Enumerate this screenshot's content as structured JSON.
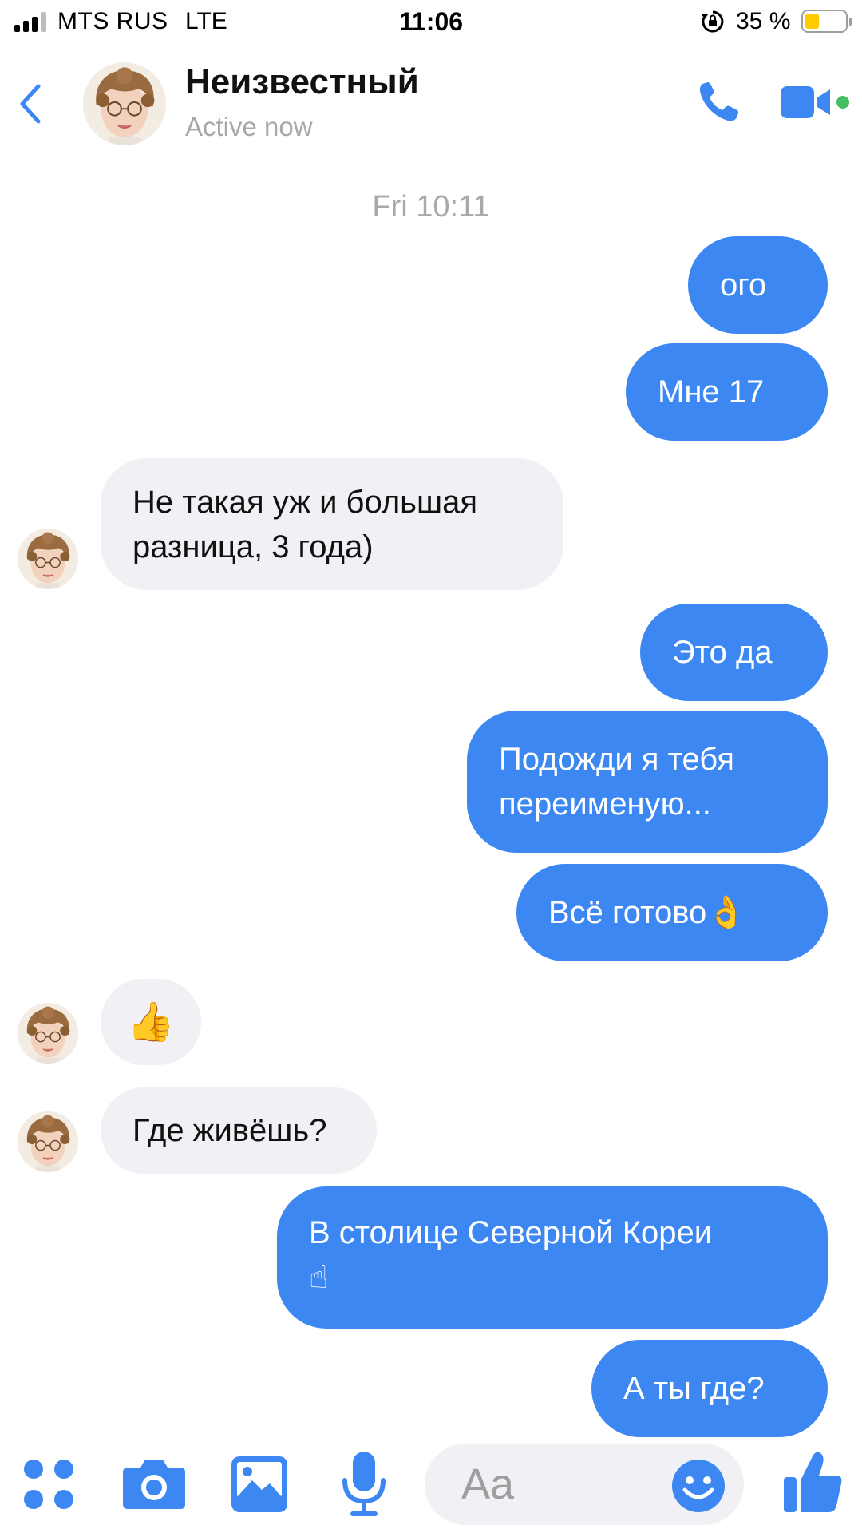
{
  "status_bar": {
    "carrier": "MTS RUS",
    "network": "LTE",
    "time": "11:06",
    "battery_percent": "35 %",
    "battery_level": 0.35,
    "signal_bars": 3,
    "signal_total": 4
  },
  "header": {
    "contact_name": "Неизвестный",
    "contact_status": "Active now",
    "back_icon": "chevron-left-icon",
    "call_icon": "phone-icon",
    "video_icon": "video-camera-icon"
  },
  "conversation": {
    "timestamp": "Fri 10:11",
    "messages": [
      {
        "from": "me",
        "text": "ого"
      },
      {
        "from": "me",
        "text": "Мне 17"
      },
      {
        "from": "them",
        "text": "Не такая уж и большая разница, 3 года)"
      },
      {
        "from": "me",
        "text": "Это да"
      },
      {
        "from": "me",
        "text": "Подожди я тебя переименую..."
      },
      {
        "from": "me",
        "text": "Всё готово",
        "emoji": "👌"
      },
      {
        "from": "them",
        "emoji": "👍"
      },
      {
        "from": "them",
        "text": "Где живёшь?"
      },
      {
        "from": "me",
        "text": "В столице Северной Кореи",
        "emoji": "☝"
      },
      {
        "from": "me",
        "text": "А ты где?"
      }
    ]
  },
  "composer": {
    "placeholder": "Aa",
    "icons": [
      "apps-grid-icon",
      "camera-icon",
      "photo-gallery-icon",
      "microphone-icon",
      "emoji-smiley-icon",
      "thumbs-up-icon"
    ]
  },
  "colors": {
    "accent": "#3c87f1",
    "incoming_bubble": "#f1f0f4",
    "online": "#45bd62",
    "battery": "#ffcc00"
  }
}
